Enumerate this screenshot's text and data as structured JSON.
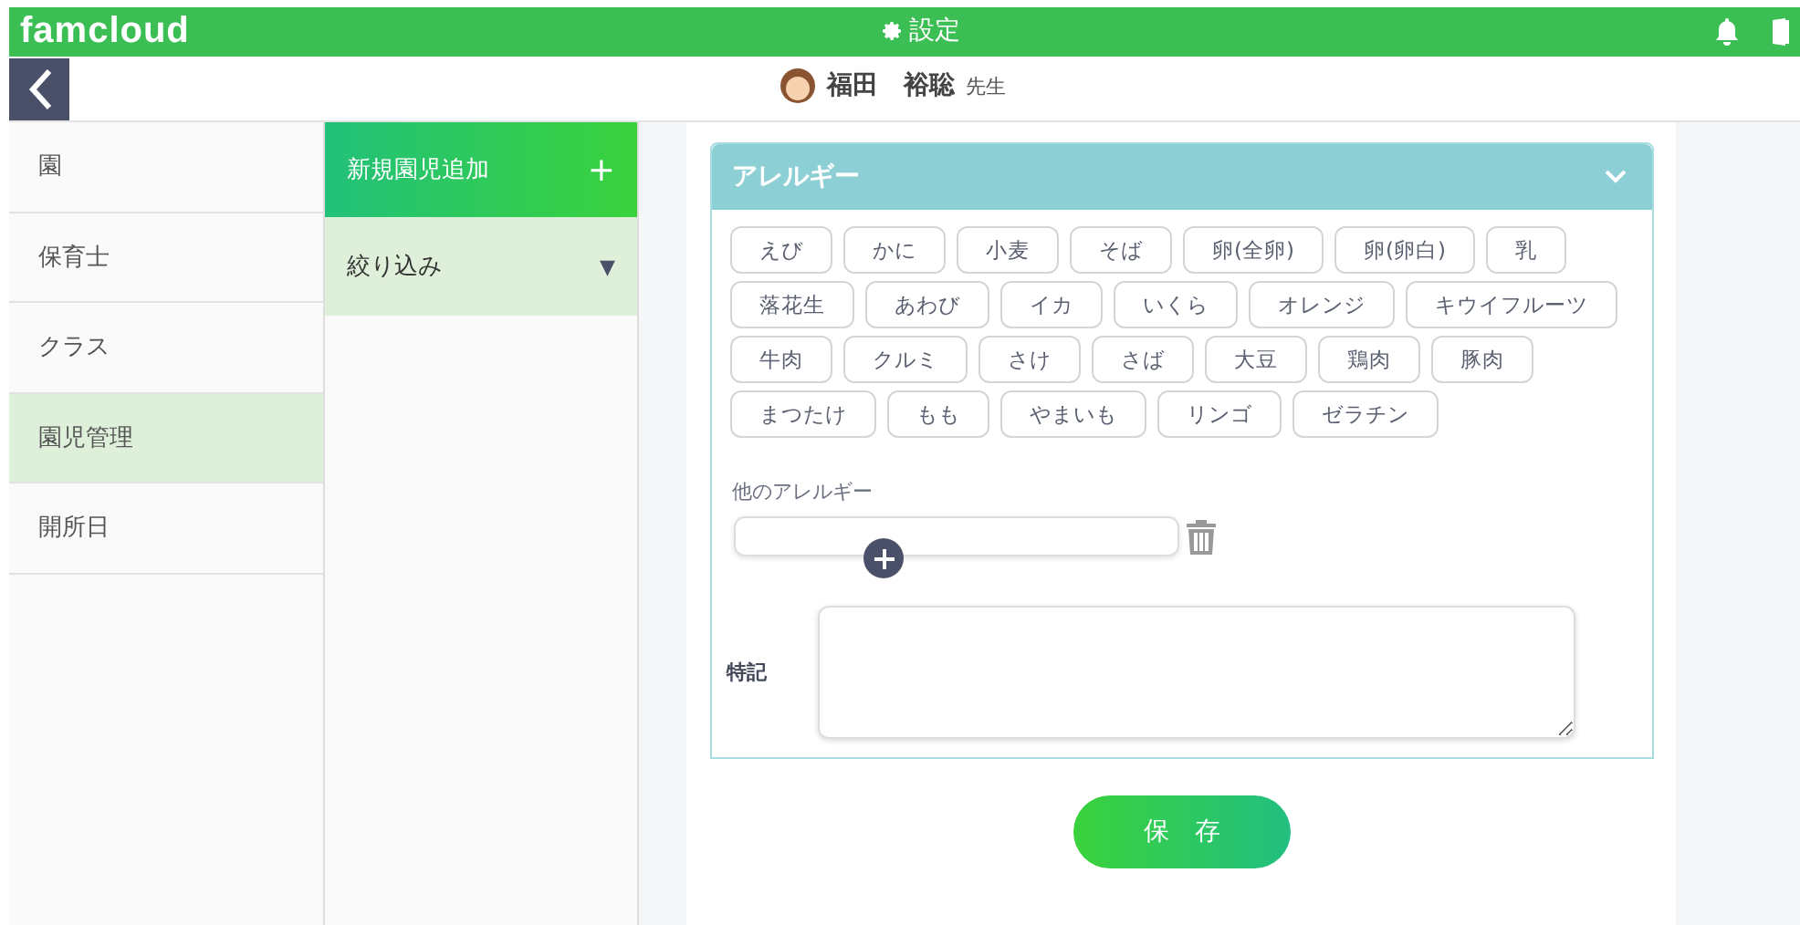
{
  "header": {
    "logo": "famcloud",
    "title": "設定"
  },
  "user_bar": {
    "name": "福田　裕聡",
    "role": "先生"
  },
  "sidebar": {
    "items": [
      {
        "label": "園",
        "selected": false
      },
      {
        "label": "保育士",
        "selected": false
      },
      {
        "label": "クラス",
        "selected": false
      },
      {
        "label": "園児管理",
        "selected": true
      },
      {
        "label": "開所日",
        "selected": false
      }
    ]
  },
  "submenu": {
    "add_button": {
      "label": "新規園児追加",
      "icon": "+"
    },
    "filter": {
      "label": "絞り込み",
      "icon": "▼"
    }
  },
  "allergy_panel": {
    "title": "アレルギー",
    "expanded": true,
    "chips": [
      "えび",
      "かに",
      "小麦",
      "そば",
      "卵(全卵)",
      "卵(卵白)",
      "乳",
      "落花生",
      "あわび",
      "イカ",
      "いくら",
      "オレンジ",
      "キウイフルーツ",
      "牛肉",
      "クルミ",
      "さけ",
      "さば",
      "大豆",
      "鶏肉",
      "豚肉",
      "まつたけ",
      "もも",
      "やまいも",
      "リンゴ",
      "ゼラチン"
    ],
    "other_label": "他のアレルギー",
    "notes_label": "特記"
  },
  "save_button": "保　存"
}
